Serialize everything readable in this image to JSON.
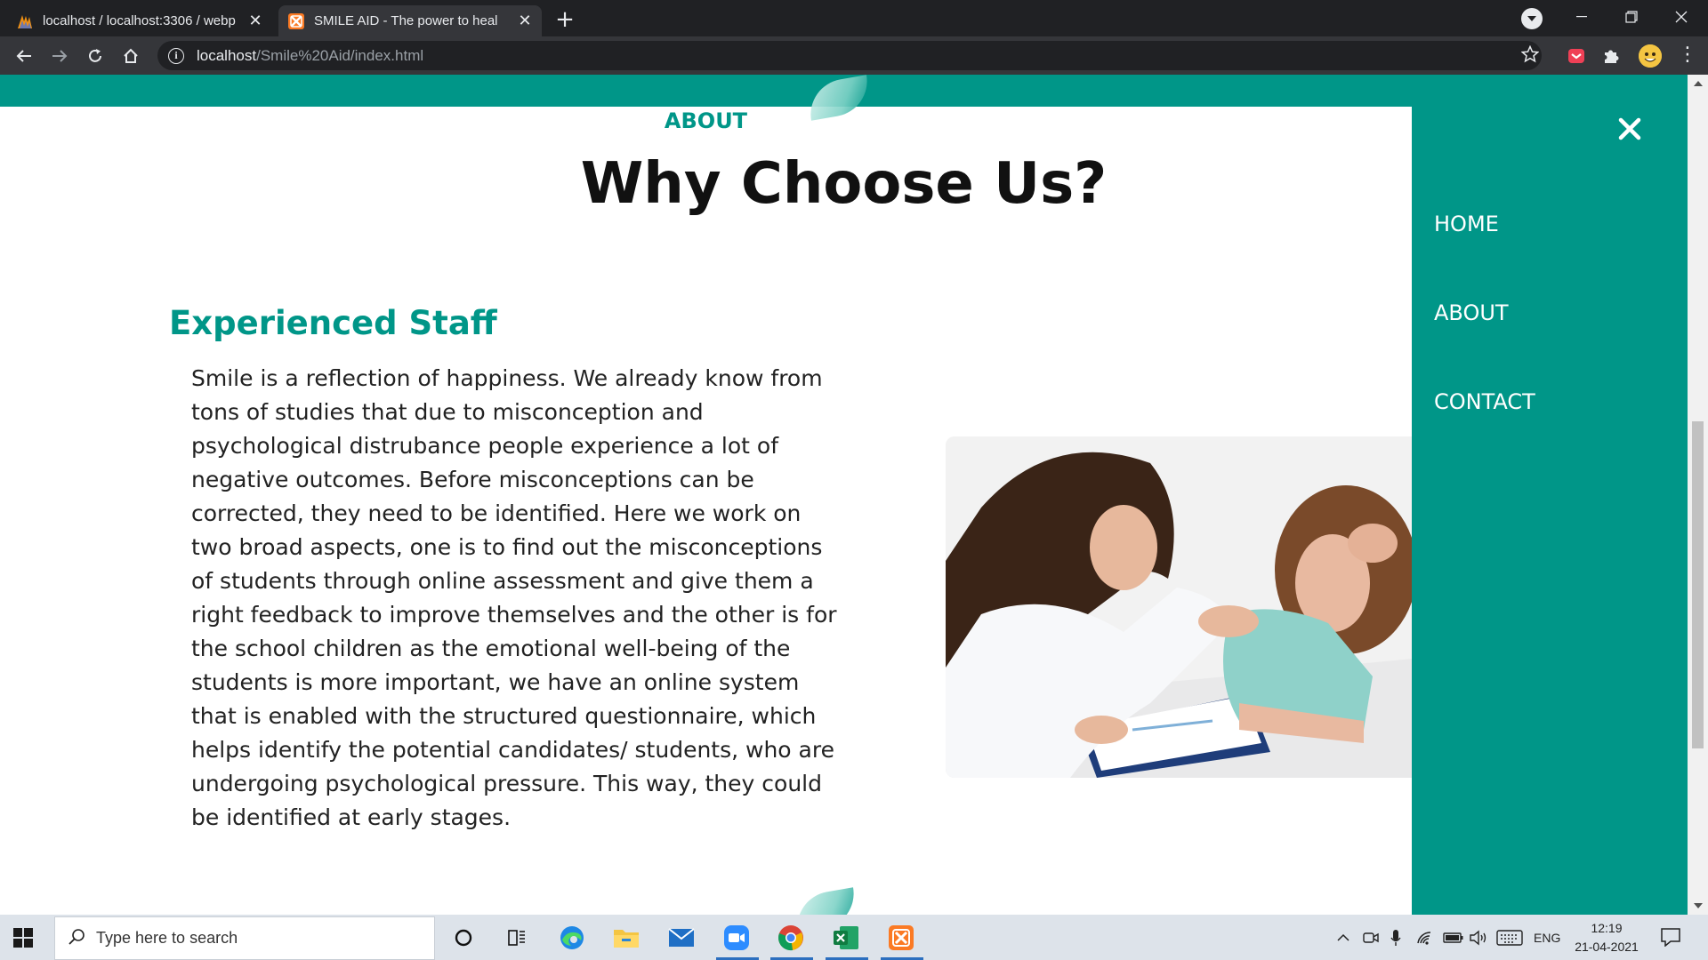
{
  "browser": {
    "tabs": [
      {
        "title": "localhost / localhost:3306 / webp",
        "active": false
      },
      {
        "title": "SMILE AID - The power to heal",
        "active": true
      }
    ],
    "new_tab_label": "+",
    "url_host": "localhost",
    "url_path": "/Smile%20Aid/index.html"
  },
  "page": {
    "section_label": "ABOUT",
    "title": "Why Choose Us?",
    "heading": "Experienced Staff",
    "body": "Smile is a reflection of happiness. We already know from tons of studies that due to misconception and psychological distrubance people experience a lot of negative outcomes. Before misconceptions can be corrected, they need to be identified. Here we work on two broad aspects, one is to find out the misconceptions of students through online assessment and give them a right feedback to improve themselves and the other is for the school children as the emotional well-being of the students is more important, we have an online system that is enabled with the structured questionnaire, which helps identify the potential candidates/ students, who are undergoing psychological pressure. This way, they could be identified at early stages.",
    "image_alt": "Doctor comforting a young girl patient"
  },
  "side_menu": {
    "items": [
      "HOME",
      "ABOUT",
      "CONTACT"
    ]
  },
  "colors": {
    "brand": "#009688",
    "text": "#222222"
  },
  "taskbar": {
    "search_placeholder": "Type here to search",
    "language": "ENG",
    "time": "12:19",
    "date": "21-04-2021"
  }
}
